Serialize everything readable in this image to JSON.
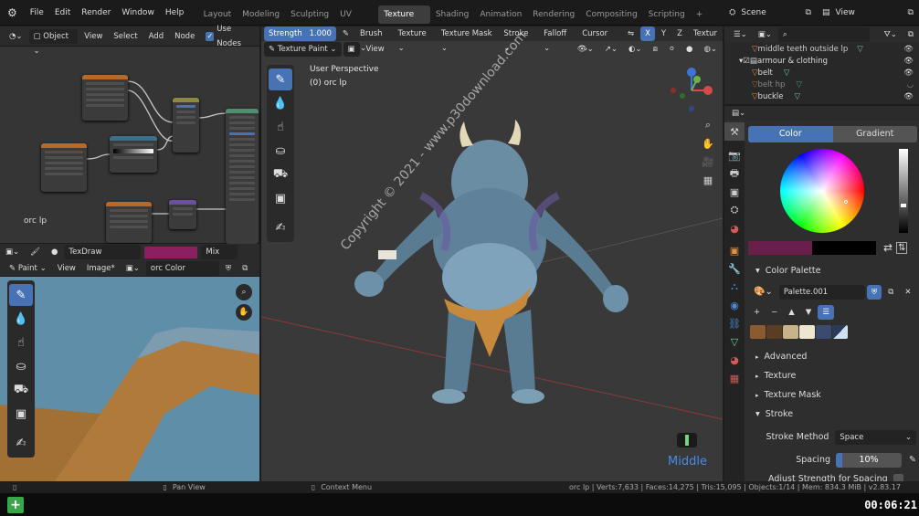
{
  "menu": {
    "items": [
      "File",
      "Edit",
      "Render",
      "Window",
      "Help"
    ]
  },
  "workspaces": {
    "tabs": [
      "Layout",
      "Modeling",
      "Sculpting",
      "UV Editing",
      "Texture Paint",
      "Shading",
      "Animation",
      "Rendering",
      "Compositing",
      "Scripting"
    ],
    "active": "Texture Paint",
    "add": "+"
  },
  "scene": {
    "label": "Scene"
  },
  "view_layer": {
    "label": "View Layer"
  },
  "node_editor": {
    "header": {
      "mode": "Object",
      "view": "View",
      "select": "Select",
      "add": "Add",
      "node": "Node",
      "use_nodes": "Use Nodes"
    },
    "object_label": "orc lp"
  },
  "texture_slot": {
    "name": "TexDraw",
    "blend": "Mix",
    "color": "#8a2060"
  },
  "image_editor": {
    "mode": "Paint",
    "view": "View",
    "image": "Image*",
    "image_name": "orc Color"
  },
  "viewport": {
    "header": {
      "strength_label": "Strength",
      "strength_value": "1.000",
      "brush": "Brush",
      "texture": "Texture",
      "texture_mask": "Texture Mask",
      "stroke": "Stroke",
      "falloff": "Falloff",
      "cursor": "Cursor",
      "mode": "Texture Paint",
      "view": "View",
      "x": "X",
      "y": "Y",
      "z": "Z",
      "texture_cut": "Textur"
    },
    "perspective": "User Perspective",
    "object": "(0) orc lp",
    "watermark": "Copyright © 2021 - www.p30download.com",
    "mouse_label": "Middle"
  },
  "outliner": {
    "items": [
      {
        "label": "middle teeth outside lp"
      },
      {
        "label": "armour & clothing"
      },
      {
        "label": "belt"
      },
      {
        "label": "belt hp"
      },
      {
        "label": "buckle"
      }
    ]
  },
  "properties": {
    "tabs": {
      "color": "Color",
      "gradient": "Gradient"
    },
    "primary_color": "#6a1e4c",
    "secondary_color": "#000000",
    "color_palette_label": "Color Palette",
    "palette_name": "Palette.001",
    "palette_swatches": [
      "#8a5a30",
      "#5b3d24",
      "#c9b48a",
      "#efe6cf",
      "#3b4b6e",
      "#2c3a5a"
    ],
    "sections": [
      "Advanced",
      "Texture",
      "Texture Mask",
      "Stroke"
    ],
    "stroke_method_label": "Stroke Method",
    "stroke_method_value": "Space",
    "spacing_label": "Spacing",
    "spacing_value": "10%",
    "adjust_label": "Adjust Strength for Spacing"
  },
  "status": {
    "pan": "Pan View",
    "context": "Context Menu",
    "stats": "orc lp | Verts:7,633 | Faces:14,275 | Tris:15,095 | Objects:1/14 | Mem: 834.3 MiB | v2.83.17"
  },
  "timer": {
    "value": "00:06:21"
  }
}
